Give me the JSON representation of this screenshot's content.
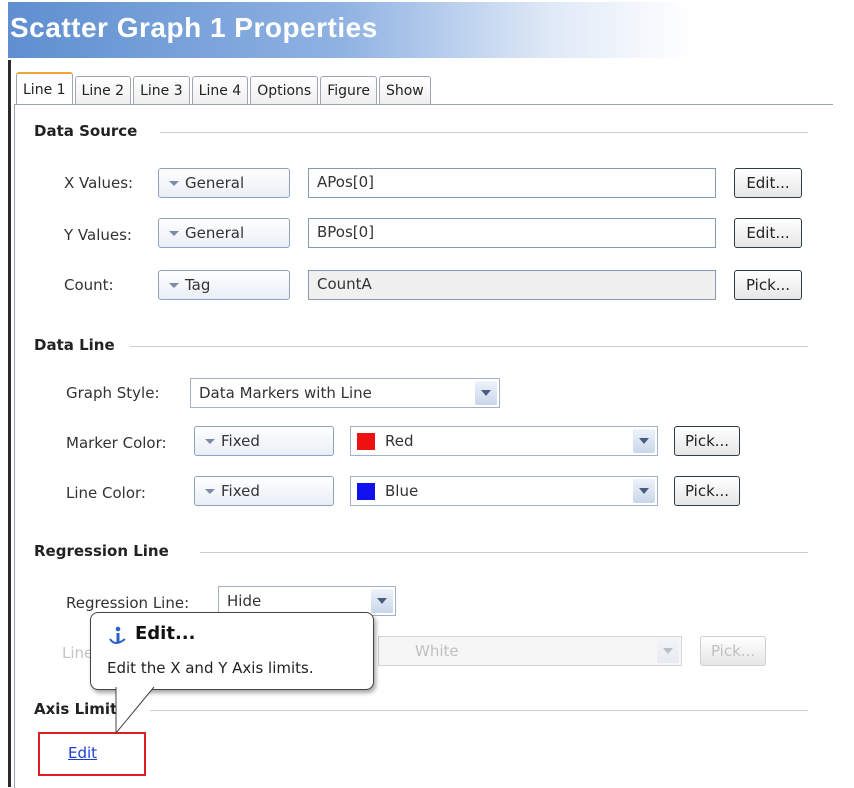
{
  "window": {
    "title": "Scatter Graph 1 Properties"
  },
  "tabs": [
    "Line 1",
    "Line 2",
    "Line 3",
    "Line 4",
    "Options",
    "Figure",
    "Show"
  ],
  "data_source": {
    "heading": "Data Source",
    "x_values": {
      "label": "X Values:",
      "mode": "General",
      "value": "APos[0]",
      "button": "Edit..."
    },
    "y_values": {
      "label": "Y Values:",
      "mode": "General",
      "value": "BPos[0]",
      "button": "Edit..."
    },
    "count": {
      "label": "Count:",
      "mode": "Tag",
      "value": "CountA",
      "button": "Pick..."
    }
  },
  "data_line": {
    "heading": "Data Line",
    "graph_style": {
      "label": "Graph Style:",
      "value": "Data Markers with Line"
    },
    "marker_color": {
      "label": "Marker Color:",
      "mode": "Fixed",
      "value": "Red",
      "swatch": "#ee1111",
      "button": "Pick..."
    },
    "line_color": {
      "label": "Line Color:",
      "mode": "Fixed",
      "value": "Blue",
      "swatch": "#1111ee",
      "button": "Pick..."
    }
  },
  "regression_line": {
    "heading": "Regression Line",
    "regression": {
      "label": "Regression Line:",
      "value": "Hide"
    },
    "line_color": {
      "label": "Line Color:",
      "value": "White",
      "button": "Pick..."
    }
  },
  "axis_limits": {
    "heading": "Axis Limits",
    "link": "Edit"
  },
  "tooltip": {
    "title": "Edit...",
    "description": "Edit the X and Y Axis limits.",
    "icon": "info-icon"
  },
  "colors": {
    "highlight": "#e02020",
    "link": "#1a3fd6",
    "tab_accent": "#f0a43a"
  }
}
